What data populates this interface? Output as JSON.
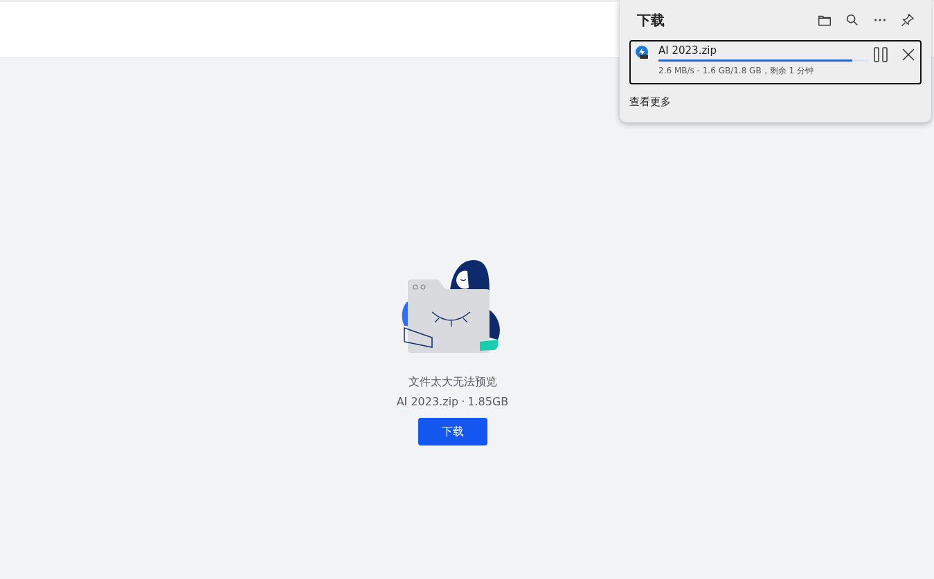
{
  "preview": {
    "message": "文件太大无法预览",
    "file_name": "AI 2023.zip",
    "separator": "·",
    "file_size": "1.85GB",
    "download_button": "下载"
  },
  "downloads_panel": {
    "title": "下载",
    "items": [
      {
        "name": "AI 2023.zip",
        "level": 0.92,
        "status": "2.6 MB/s - 1.6 GB/1.8 GB，剩余 1 分钟",
        "selected": true
      }
    ],
    "see_more": "查看更多"
  }
}
